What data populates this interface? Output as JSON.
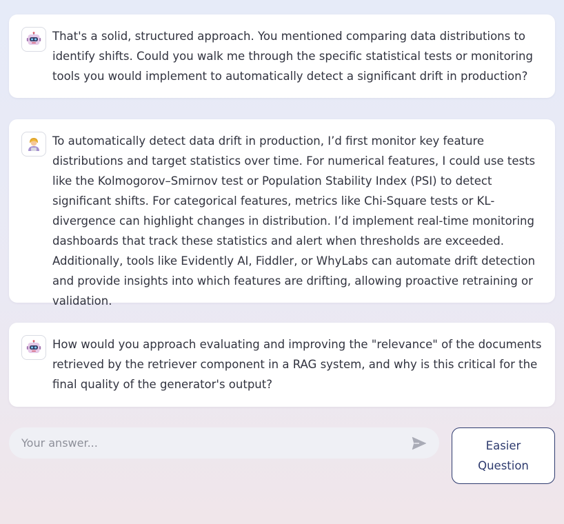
{
  "messages": [
    {
      "role": "assistant",
      "avatar": "robot-icon",
      "text": "That's a solid, structured approach. You mentioned comparing data distributions to identify shifts. Could you walk me through the specific statistical tests or monitoring tools you would implement to automatically detect a significant drift in production?"
    },
    {
      "role": "user",
      "avatar": "user-avatar-icon",
      "text": "To automatically detect data drift in production, I’d first monitor key feature distributions and target statistics over time. For numerical features, I could use tests like the Kolmogorov–Smirnov test or Population Stability Index (PSI) to detect significant shifts. For categorical features, metrics like Chi-Square tests or KL-divergence can highlight changes in distribution. I’d implement real-time monitoring dashboards that track these statistics and alert when thresholds are exceeded. Additionally, tools like Evidently AI, Fiddler, or WhyLabs can automate drift detection and provide insights into which features are drifting, allowing proactive retraining or validation."
    },
    {
      "role": "assistant",
      "avatar": "robot-icon",
      "text": "How would you approach evaluating and improving the \"relevance\" of the documents retrieved by the retriever component in a RAG system, and why is this critical for the final quality of the generator's output?"
    }
  ],
  "input": {
    "placeholder": "Your answer...",
    "value": "",
    "send_icon": "send-icon"
  },
  "easier_button": {
    "label": "Easier Question"
  },
  "colors": {
    "card": "#ffffff",
    "text": "#31333f",
    "button_border": "#2d3a6e",
    "input_bg": "#eff0f5"
  }
}
